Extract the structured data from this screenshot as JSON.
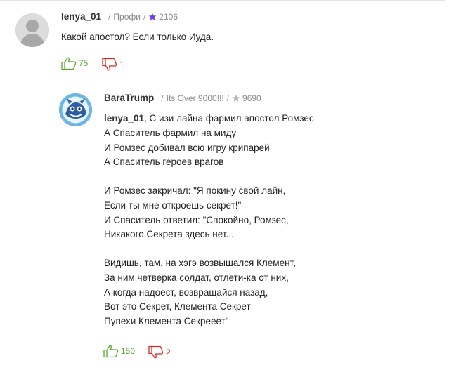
{
  "comments": [
    {
      "username": "lenya_01",
      "rank": "Профи",
      "rating": "2106",
      "star_color": "#6b3fe0",
      "text": "Какой апостол? Если только Иуда.",
      "likes": "75",
      "dislikes": "1"
    },
    {
      "username": "BaraTrump",
      "rank": "Its Over 9000!!!",
      "rating": "9690",
      "star_color": "#b5b5b5",
      "mention": "lenya_01",
      "first_line_rest": ", С изи лайна фармил апостол Ромзес",
      "text": "А Спаситель фармил на миду\nИ Ромзес добивал всю игру крипарей\nА Спаситель героев врагов\n\nИ Ромзес закричал: \"Я покину свой лайн,\nЕсли ты мне откроешь секрет!\"\nИ Спаситель ответил: \"Спокойно, Ромзес,\nНикакого Секрета здесь нет...\n\nВидишь, там, на хэгэ возвышался Клемент,\nЗа ним четверка солдат, отлети-ка от них,\nА когда надоест, возвращайся назад,\nВот это Секрет, Клемента Секрет\nПупехи Клемента Секрееет\"",
      "likes": "150",
      "dislikes": "2"
    }
  ],
  "colors": {
    "like": "#5ba52b",
    "dislike": "#d42a2a",
    "meta": "#8a8a8a"
  }
}
